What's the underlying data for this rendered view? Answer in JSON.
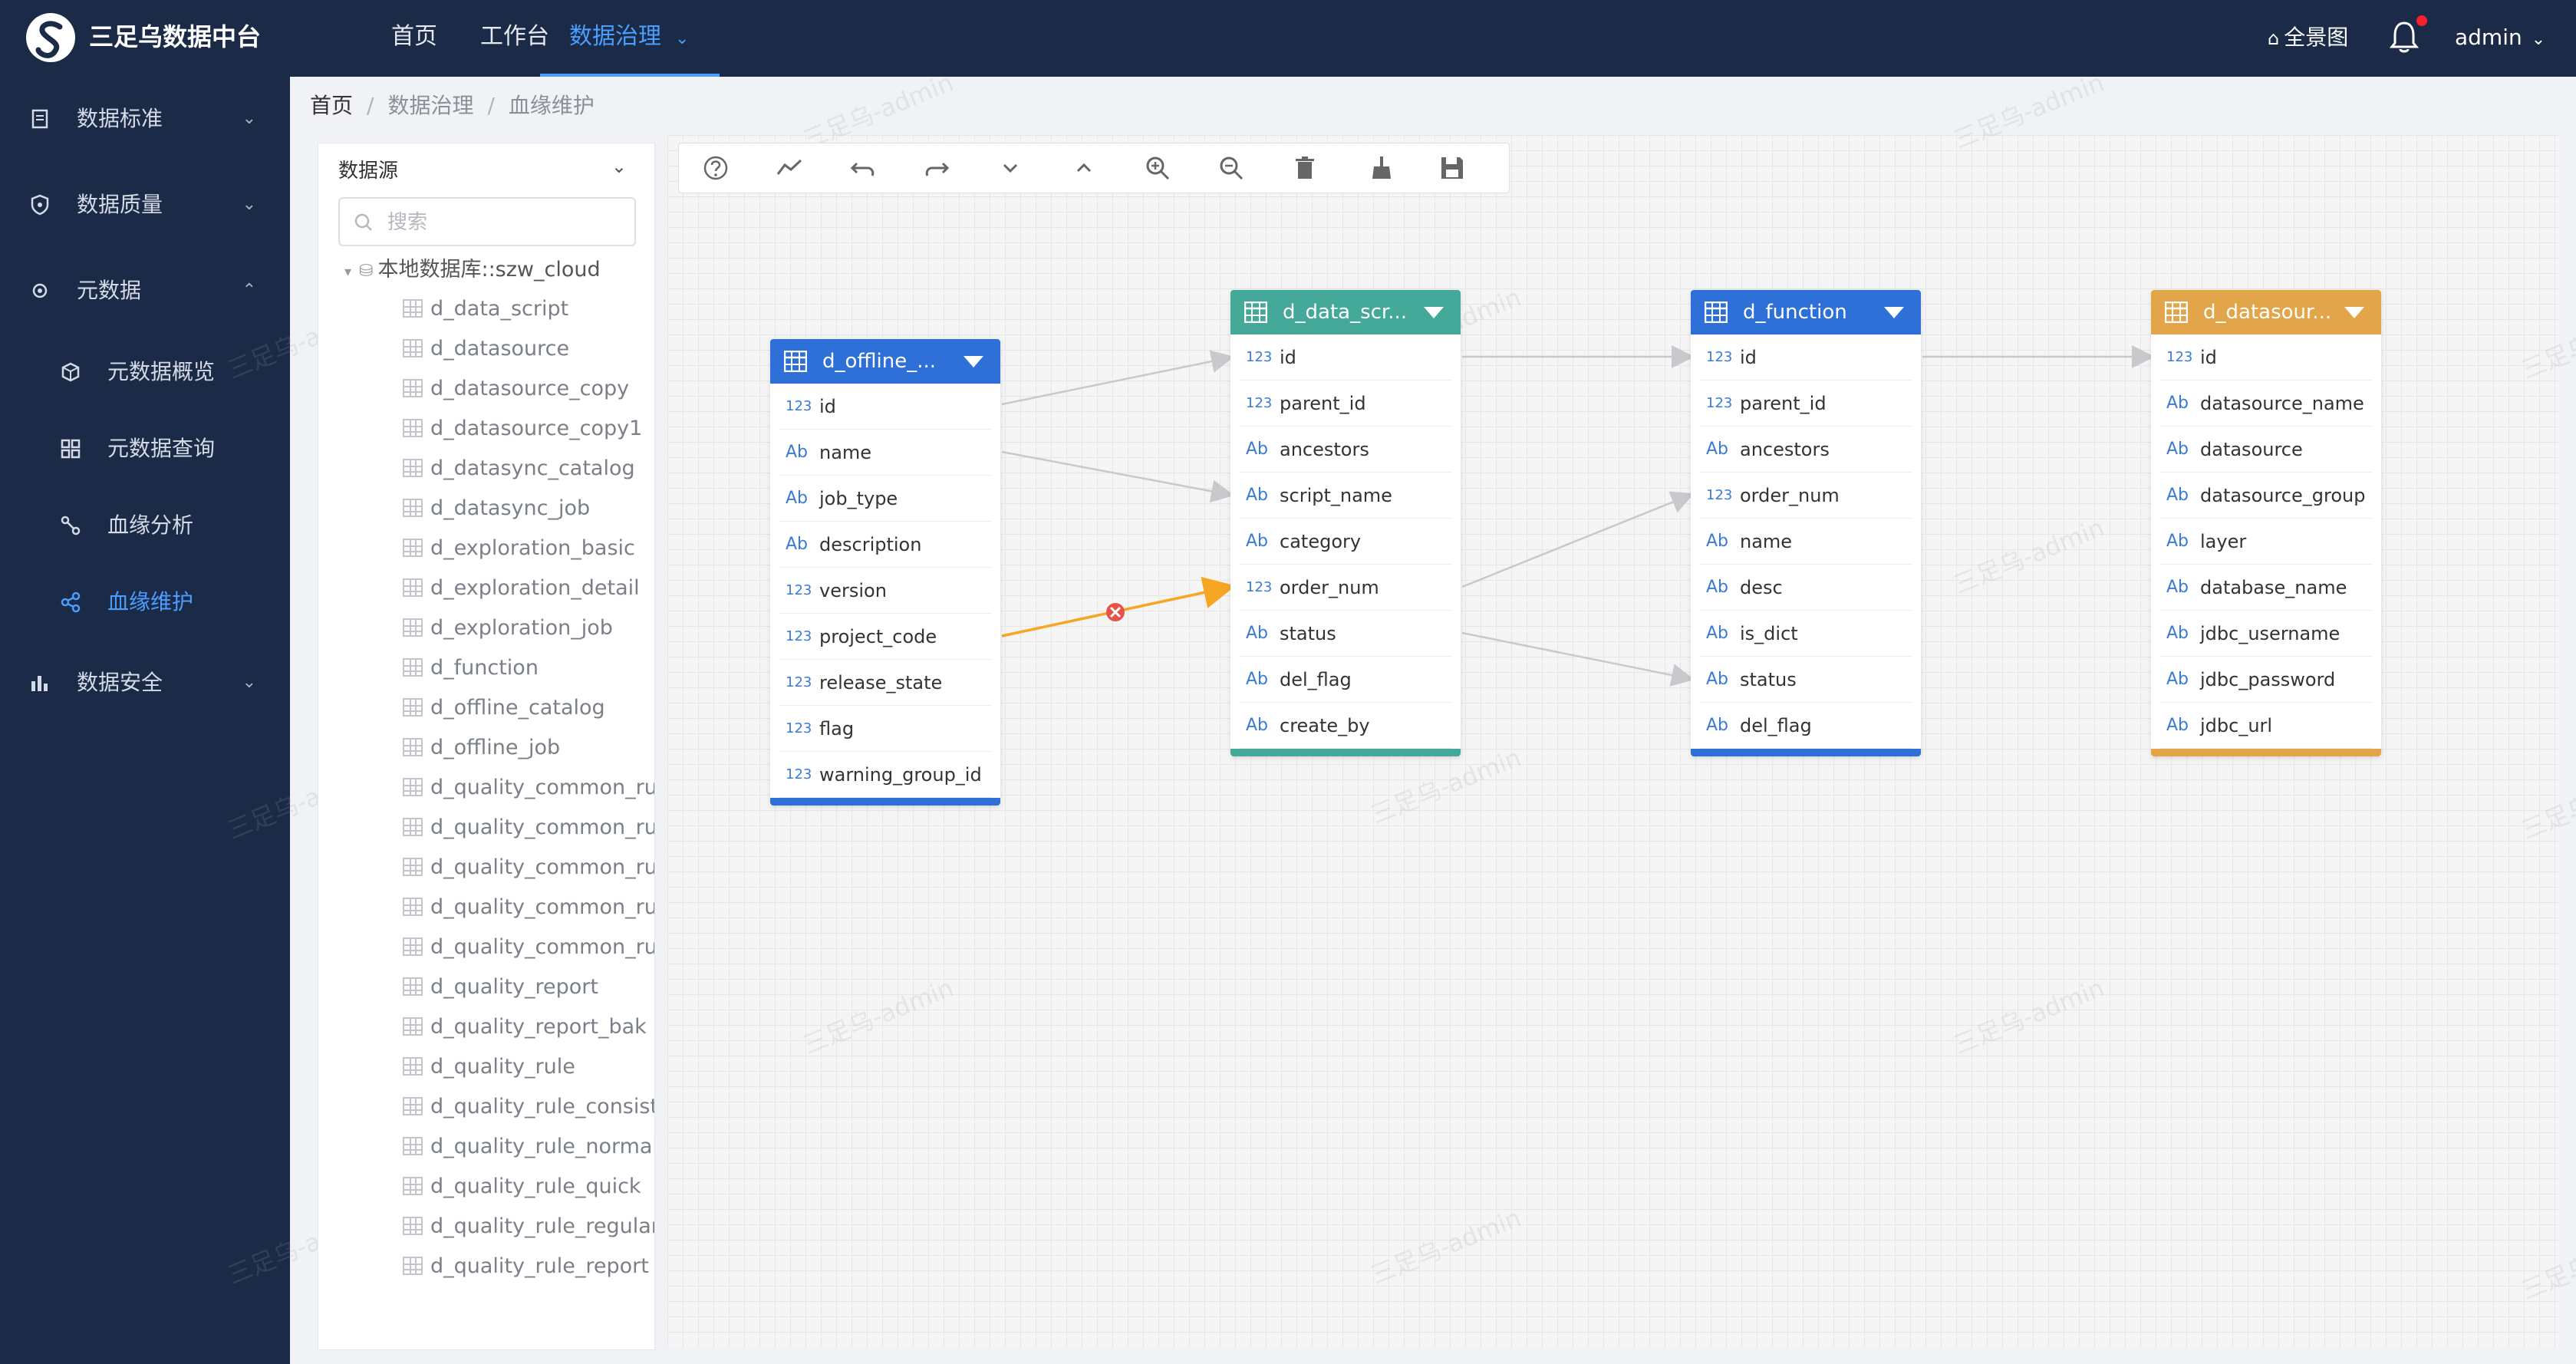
{
  "app": {
    "title": "三足乌数据中台"
  },
  "top_nav": {
    "items": [
      {
        "label": "首页"
      },
      {
        "label": "工作台"
      },
      {
        "label": "数据治理"
      }
    ],
    "panorama_label": "全景图",
    "user": "admin"
  },
  "sidebar": {
    "items": [
      {
        "label": "数据标准"
      },
      {
        "label": "数据质量"
      },
      {
        "label": "元数据"
      },
      {
        "label": "元数据概览"
      },
      {
        "label": "元数据查询"
      },
      {
        "label": "血缘分析"
      },
      {
        "label": "血缘维护"
      },
      {
        "label": "数据安全"
      }
    ]
  },
  "breadcrumb": [
    "首页",
    "数据治理",
    "血缘维护"
  ],
  "datasource_panel": {
    "header": "数据源",
    "search_placeholder": "搜索",
    "root": "本地数据库::szw_cloud",
    "tables": [
      "d_data_script",
      "d_datasource",
      "d_datasource_copy",
      "d_datasource_copy1",
      "d_datasync_catalog",
      "d_datasync_job",
      "d_exploration_basic",
      "d_exploration_detail",
      "d_exploration_job",
      "d_function",
      "d_offline_catalog",
      "d_offline_job",
      "d_quality_common_ru",
      "d_quality_common_ru",
      "d_quality_common_ru",
      "d_quality_common_ru",
      "d_quality_common_ru",
      "d_quality_report",
      "d_quality_report_bak",
      "d_quality_rule",
      "d_quality_rule_consist",
      "d_quality_rule_normali",
      "d_quality_rule_quick",
      "d_quality_rule_regular",
      "d_quality_rule_report"
    ]
  },
  "toolbar": {
    "buttons": [
      "help-icon",
      "line-chart-icon",
      "undo-icon",
      "redo-icon",
      "chevron-down-icon",
      "chevron-up-icon",
      "zoom-in-icon",
      "zoom-out-icon",
      "delete-icon",
      "clear-brush-icon",
      "save-icon"
    ]
  },
  "watermark": "三足乌-admin",
  "colors": {
    "nav_bg": "#1b2a47",
    "accent": "#4a9eff",
    "card_blue": "#2f6fd8",
    "card_green": "#45a99a",
    "card_orange": "#e3a54a",
    "edge_active": "#f5a623",
    "edge_delete": "#e5534b"
  },
  "cards": [
    {
      "title": "d_offline_...",
      "fields": [
        {
          "type": "123",
          "name": "id"
        },
        {
          "type": "Ab",
          "name": "name"
        },
        {
          "type": "Ab",
          "name": "job_type"
        },
        {
          "type": "Ab",
          "name": "description"
        },
        {
          "type": "123",
          "name": "version"
        },
        {
          "type": "123",
          "name": "project_code"
        },
        {
          "type": "123",
          "name": "release_state"
        },
        {
          "type": "123",
          "name": "flag"
        },
        {
          "type": "123",
          "name": "warning_group_id"
        }
      ]
    },
    {
      "title": "d_data_scr...",
      "fields": [
        {
          "type": "123",
          "name": "id"
        },
        {
          "type": "123",
          "name": "parent_id"
        },
        {
          "type": "Ab",
          "name": "ancestors"
        },
        {
          "type": "Ab",
          "name": "script_name"
        },
        {
          "type": "Ab",
          "name": "category"
        },
        {
          "type": "123",
          "name": "order_num"
        },
        {
          "type": "Ab",
          "name": "status"
        },
        {
          "type": "Ab",
          "name": "del_flag"
        },
        {
          "type": "Ab",
          "name": "create_by"
        }
      ]
    },
    {
      "title": "d_function",
      "fields": [
        {
          "type": "123",
          "name": "id"
        },
        {
          "type": "123",
          "name": "parent_id"
        },
        {
          "type": "Ab",
          "name": "ancestors"
        },
        {
          "type": "123",
          "name": "order_num"
        },
        {
          "type": "Ab",
          "name": "name"
        },
        {
          "type": "Ab",
          "name": "desc"
        },
        {
          "type": "Ab",
          "name": "is_dict"
        },
        {
          "type": "Ab",
          "name": "status"
        },
        {
          "type": "Ab",
          "name": "del_flag"
        }
      ]
    },
    {
      "title": "d_datasour...",
      "fields": [
        {
          "type": "123",
          "name": "id"
        },
        {
          "type": "Ab",
          "name": "datasource_name"
        },
        {
          "type": "Ab",
          "name": "datasource"
        },
        {
          "type": "Ab",
          "name": "datasource_group"
        },
        {
          "type": "Ab",
          "name": "layer"
        },
        {
          "type": "Ab",
          "name": "database_name"
        },
        {
          "type": "Ab",
          "name": "jdbc_username"
        },
        {
          "type": "Ab",
          "name": "jdbc_password"
        },
        {
          "type": "Ab",
          "name": "jdbc_url"
        }
      ]
    }
  ]
}
